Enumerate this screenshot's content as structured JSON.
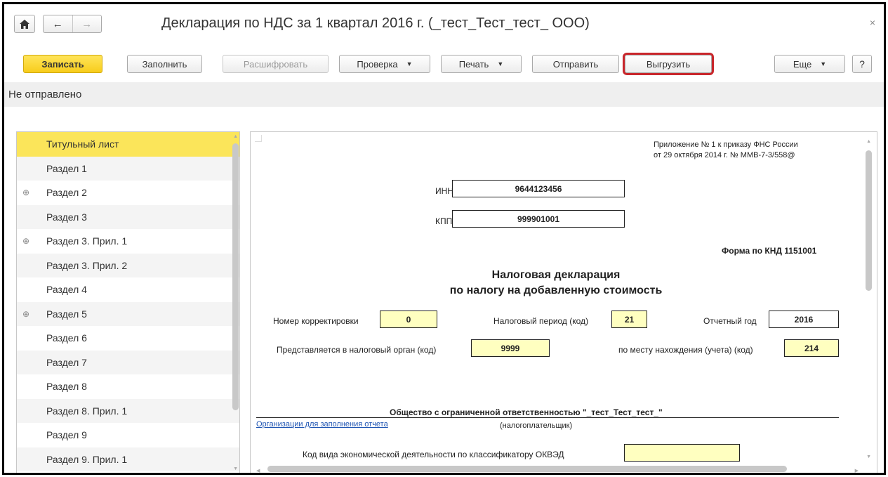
{
  "window": {
    "title": "Декларация по НДС за 1 квартал 2016 г. (_тест_Тест_тест_ ООО)",
    "close_symbol": "×"
  },
  "nav": {
    "home_icon": "home-icon",
    "back_symbol": "←",
    "forward_symbol": "→"
  },
  "toolbar": {
    "save": "Записать",
    "fill": "Заполнить",
    "decode": "Расшифровать",
    "check": "Проверка",
    "print": "Печать",
    "send": "Отправить",
    "export": "Выгрузить",
    "more": "Еще",
    "help": "?",
    "dropdown_symbol": "▼"
  },
  "status": {
    "text": "Не отправлено"
  },
  "sections": [
    {
      "label": "Титульный лист",
      "expandable": false,
      "selected": true
    },
    {
      "label": "Раздел 1",
      "expandable": false
    },
    {
      "label": "Раздел 2",
      "expandable": true
    },
    {
      "label": "Раздел 3",
      "expandable": false
    },
    {
      "label": "Раздел 3. Прил. 1",
      "expandable": true
    },
    {
      "label": "Раздел 3. Прил. 2",
      "expandable": false
    },
    {
      "label": "Раздел 4",
      "expandable": false
    },
    {
      "label": "Раздел 5",
      "expandable": true
    },
    {
      "label": "Раздел 6",
      "expandable": false
    },
    {
      "label": "Раздел 7",
      "expandable": false
    },
    {
      "label": "Раздел 8",
      "expandable": false
    },
    {
      "label": "Раздел 8. Прил. 1",
      "expandable": false
    },
    {
      "label": "Раздел 9",
      "expandable": false
    },
    {
      "label": "Раздел 9. Прил. 1",
      "expandable": false
    }
  ],
  "expand_symbol": "⊕",
  "form": {
    "appendix_line1": "Приложение № 1 к приказу ФНС России",
    "appendix_line2": "от 29 октября 2014 г. № ММВ-7-3/558@",
    "inn_label": "ИНН",
    "inn_value": "9644123456",
    "kpp_label": "КПП",
    "kpp_value": "999901001",
    "knd_form": "Форма по КНД 1151001",
    "heading_line1": "Налоговая декларация",
    "heading_line2": "по налогу на добавленную стоимость",
    "correction_label": "Номер корректировки",
    "correction_value": "0",
    "period_label": "Налоговый период (код)",
    "period_value": "21",
    "year_label": "Отчетный год",
    "year_value": "2016",
    "authority_label": "Представляется в налоговый орган (код)",
    "authority_value": "9999",
    "location_label": "по месту нахождения (учета) (код)",
    "location_value": "214",
    "org_name": "Общество с ограниченной ответственностью \"_тест_Тест_тест_\"",
    "org_link": "Организации для заполнения отчета",
    "taxpayer_caption": "(налогоплательщик)",
    "okved_label": "Код вида экономической деятельности по классификатору ОКВЭД",
    "okved_value": ""
  }
}
